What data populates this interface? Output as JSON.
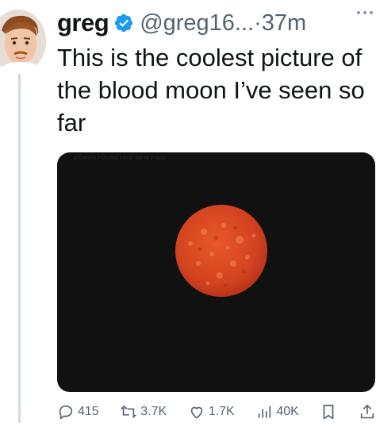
{
  "tweet": {
    "author": {
      "display_name": "greg",
      "handle": "@greg16...",
      "verified": true,
      "verified_color": "#1d9bf0"
    },
    "separator": "·",
    "timestamp": "37m",
    "text": "This is the coolest picture of the blood moon I’ve seen so far",
    "media": {
      "watermark": "@GREGYOUNG1400 NEW FIND",
      "subject_color": "#d94a22",
      "background_color": "#111112"
    },
    "actions": {
      "replies": "415",
      "reposts": "3.7K",
      "likes": "1.7K",
      "views": "40K"
    }
  },
  "icons": [
    "more-icon",
    "verified-badge-icon",
    "reply-icon",
    "repost-icon",
    "like-icon",
    "views-icon",
    "bookmark-icon",
    "share-icon"
  ]
}
